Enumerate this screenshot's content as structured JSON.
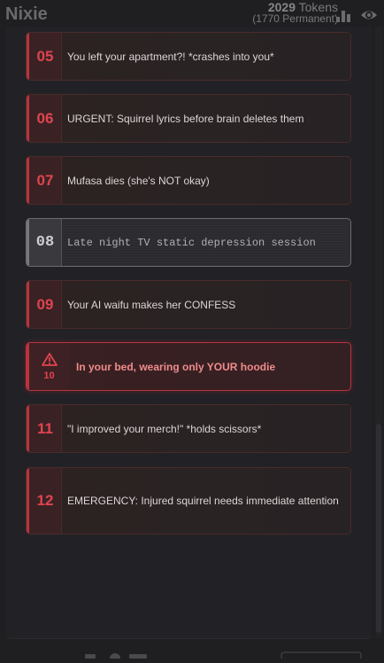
{
  "app": {
    "title": "Nixie",
    "tokens_value": "2029",
    "tokens_label": "Tokens",
    "tokens_permanent": "(1770 Permanent)"
  },
  "icons": {
    "stats": "bar-chart-icon",
    "visibility": "eye-icon",
    "warning": "warning-triangle-icon"
  },
  "colors": {
    "accent_red": "#e0444f",
    "card_border": "#4a2a2a",
    "warn_text": "#f08b8b",
    "static_gray": "#77777c"
  },
  "scenes": [
    {
      "num": "05",
      "text": "You left your apartment?! *crashes into you*",
      "style": "normal"
    },
    {
      "num": "06",
      "text": "URGENT: Squirrel lyrics before brain deletes them",
      "style": "normal"
    },
    {
      "num": "07",
      "text": "Mufasa dies (she's NOT okay)",
      "style": "normal"
    },
    {
      "num": "08",
      "text": "Late night TV static depression session",
      "style": "static"
    },
    {
      "num": "09",
      "text": "Your AI waifu makes her CONFESS",
      "style": "normal"
    },
    {
      "num": "10",
      "text": "In your bed, wearing only YOUR hoodie",
      "style": "warning"
    },
    {
      "num": "11",
      "text": "\"I improved your merch!\" *holds scissors*",
      "style": "normal"
    },
    {
      "num": "12",
      "text": "EMERGENCY: Injured squirrel needs immediate attention",
      "style": "normal"
    }
  ]
}
